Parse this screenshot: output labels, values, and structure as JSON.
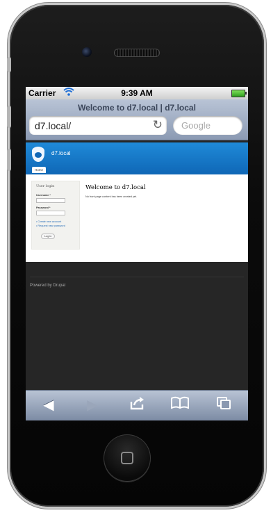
{
  "status_bar": {
    "carrier": "Carrier",
    "time": "9:39 AM"
  },
  "browser": {
    "page_title": "Welcome to d7.local | d7.local",
    "address": "d7.local/",
    "search_placeholder": "Google"
  },
  "site": {
    "name": "d7.local",
    "tabs": [
      "Home"
    ]
  },
  "login_block": {
    "title": "User login",
    "username_label": "Username *",
    "password_label": "Password *",
    "links": [
      "Create new account",
      "Request new password"
    ],
    "submit_label": "Log in"
  },
  "main": {
    "title": "Welcome to d7.local",
    "text": "No front page content has been created yet."
  },
  "footer": {
    "text": "Powered by Drupal"
  },
  "toolbar": {
    "back": "◀",
    "forward": "▶",
    "share": "⇪",
    "bookmarks": "📖",
    "pages": "⧉"
  }
}
